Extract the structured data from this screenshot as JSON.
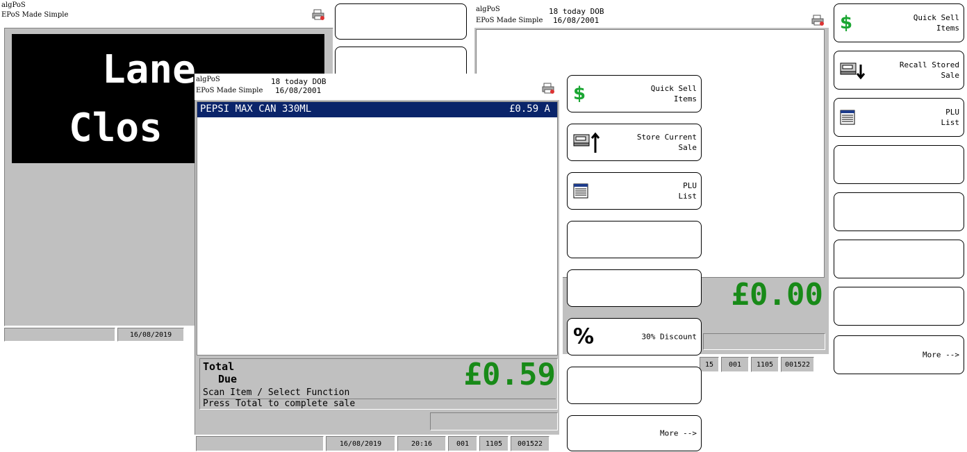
{
  "windows": {
    "back_left": {
      "app": "algPoS",
      "tagline": "EPoS Made Simple",
      "banner": [
        "Lane",
        "Clos"
      ],
      "status_date": "16/08/2019"
    },
    "back_right": {
      "app": "algPoS",
      "tagline": "EPoS Made Simple",
      "dob_label": "18 today DOB",
      "dob_date": "16/08/2001",
      "total_amount": "£0.00",
      "status": [
        "15",
        "001",
        "1105",
        "001522"
      ],
      "buttons": [
        {
          "label": "Quick Sell\nItems",
          "icon": "dollar-icon"
        },
        {
          "label": "Recall Stored\nSale",
          "icon": "recall-sale-icon"
        },
        {
          "label": "PLU\nList",
          "icon": "list-icon"
        },
        {
          "label": ""
        },
        {
          "label": ""
        },
        {
          "label": ""
        },
        {
          "label": ""
        },
        {
          "label": "More -->"
        }
      ]
    },
    "front": {
      "app": "algPoS",
      "tagline": "EPoS Made Simple",
      "dob_label": "18 today DOB",
      "dob_date": "16/08/2001",
      "item": {
        "name": "PEPSI MAX CAN 330ML",
        "price": "£0.59 A"
      },
      "total_label_1": "Total",
      "total_label_2": "Due",
      "total_amount": "£0.59",
      "message_1": "Scan Item / Select Function",
      "message_2": "Press Total to complete sale",
      "status": [
        "16/08/2019",
        "20:16",
        "001",
        "1105",
        "001522"
      ],
      "buttons": [
        {
          "label": "Quick Sell\nItems",
          "icon": "dollar-icon"
        },
        {
          "label": "Store Current\nSale",
          "icon": "store-sale-icon"
        },
        {
          "label": "PLU\nList",
          "icon": "list-icon"
        },
        {
          "label": ""
        },
        {
          "label": ""
        },
        {
          "label": "30% Discount",
          "icon": "percent-icon"
        },
        {
          "label": ""
        },
        {
          "label": "More -->"
        }
      ]
    }
  },
  "colors": {
    "accent_green": "#188a18",
    "selection_blue": "#0a246a",
    "panel_grey": "#c0c0c0"
  }
}
